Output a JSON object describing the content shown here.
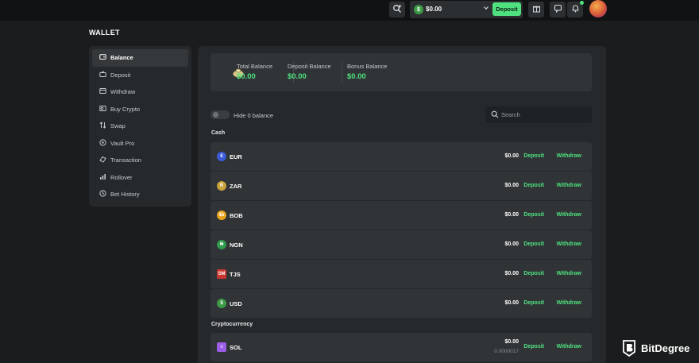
{
  "topbar": {
    "balance_amount": "$0.00",
    "balance_coin_symbol": "$",
    "deposit_label": "Deposit"
  },
  "page_title": "WALLET",
  "sidebar": {
    "items": [
      {
        "label": "Balance",
        "icon": "wallet-icon",
        "active": true
      },
      {
        "label": "Deposit",
        "icon": "deposit-icon",
        "active": false
      },
      {
        "label": "Withdraw",
        "icon": "withdraw-icon",
        "active": false
      },
      {
        "label": "Buy Crypto",
        "icon": "card-icon",
        "active": false
      },
      {
        "label": "Swap",
        "icon": "swap-icon",
        "active": false
      },
      {
        "label": "Vault Pro",
        "icon": "vault-icon",
        "active": false
      },
      {
        "label": "Transaction",
        "icon": "transaction-icon",
        "active": false
      },
      {
        "label": "Rollover",
        "icon": "rollover-icon",
        "active": false
      },
      {
        "label": "Bet History",
        "icon": "history-icon",
        "active": false
      }
    ]
  },
  "summary": {
    "total_label": "Total Balance",
    "total_value": "$0.00",
    "deposit_label": "Deposit Balance",
    "deposit_value": "$0.00",
    "bonus_label": "Bonus Balance",
    "bonus_value": "$0.00"
  },
  "filters": {
    "hide_zero_label": "Hide 0 balance",
    "search_placeholder": "Search"
  },
  "cash": {
    "section_label": "Cash",
    "rows": [
      {
        "code": "EUR",
        "symbol": "€",
        "color": "#3b5bd6",
        "amount": "$0.00",
        "deposit": "Deposit",
        "withdraw": "Withdraw"
      },
      {
        "code": "ZAR",
        "symbol": "R",
        "color": "#c8a13a",
        "amount": "$0.00",
        "deposit": "Deposit",
        "withdraw": "Withdraw"
      },
      {
        "code": "BOB",
        "symbol": "$b",
        "color": "#e8a317",
        "amount": "$0.00",
        "deposit": "Deposit",
        "withdraw": "Withdraw"
      },
      {
        "code": "NGN",
        "symbol": "₦",
        "color": "#2f9a4a",
        "amount": "$0.00",
        "deposit": "Deposit",
        "withdraw": "Withdraw"
      },
      {
        "code": "TJS",
        "symbol": "SM",
        "color": "#c8352e",
        "amount": "$0.00",
        "deposit": "Deposit",
        "withdraw": "Withdraw"
      },
      {
        "code": "USD",
        "symbol": "$",
        "color": "#3d9a45",
        "amount": "$0.00",
        "deposit": "Deposit",
        "withdraw": "Withdraw"
      }
    ]
  },
  "crypto": {
    "section_label": "Cryptocurrency",
    "rows": [
      {
        "code": "SOL",
        "symbol": "≡",
        "color": "#9b5de5",
        "amount": "$0.00",
        "sub_amount": "0.0000017",
        "deposit": "Deposit",
        "withdraw": "Withdraw"
      }
    ]
  },
  "watermark": {
    "text": "BitDegree"
  }
}
